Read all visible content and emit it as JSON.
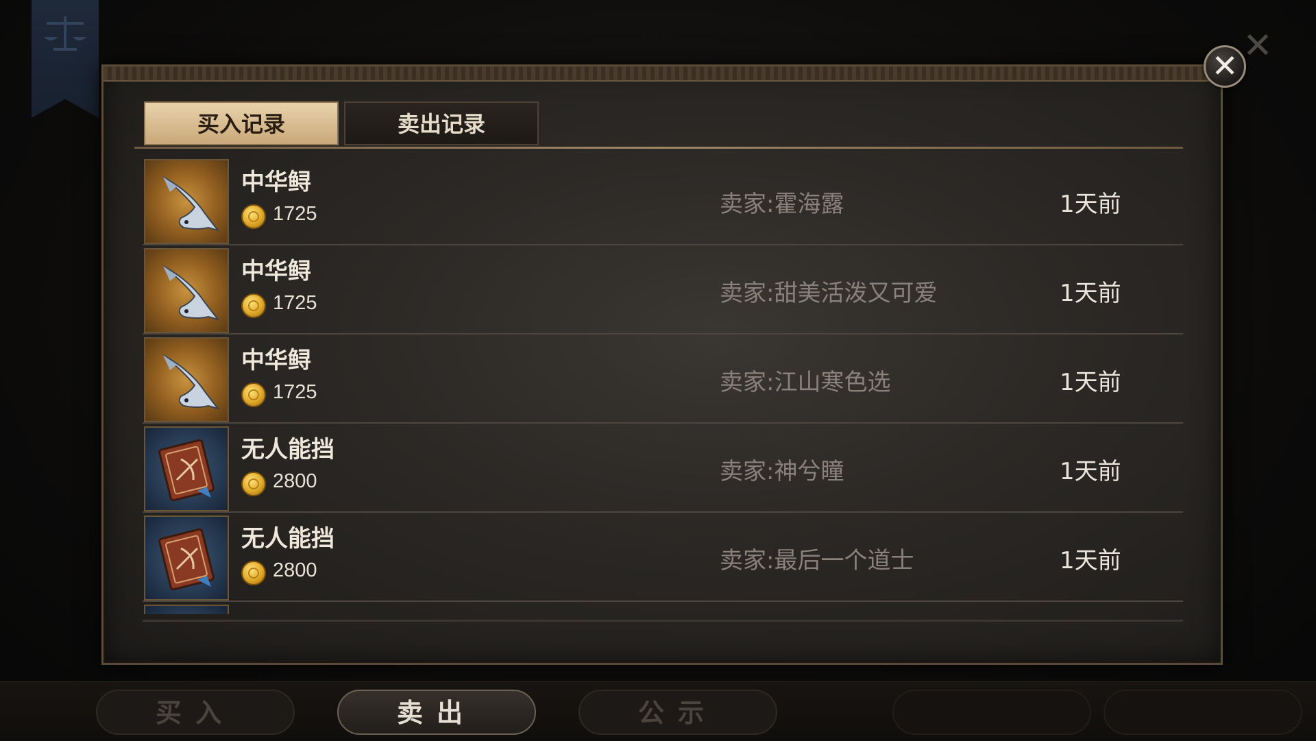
{
  "tabs": {
    "buy_records": "买入记录",
    "sell_records": "卖出记录"
  },
  "close_icon": "close-icon",
  "records": [
    {
      "name": "中华鲟",
      "price": "1725",
      "seller": "卖家:霍海露",
      "time": "1天前",
      "icon": "sturgeon-fish-icon"
    },
    {
      "name": "中华鲟",
      "price": "1725",
      "seller": "卖家:甜美活泼又可爱",
      "time": "1天前",
      "icon": "sturgeon-fish-icon"
    },
    {
      "name": "中华鲟",
      "price": "1725",
      "seller": "卖家:江山寒色选",
      "time": "1天前",
      "icon": "sturgeon-fish-icon"
    },
    {
      "name": "无人能挡",
      "price": "2800",
      "seller": "卖家:神兮瞳",
      "time": "1天前",
      "icon": "skill-book-icon"
    },
    {
      "name": "无人能挡",
      "price": "2800",
      "seller": "卖家:最后一个道士",
      "time": "1天前",
      "icon": "skill-book-icon"
    }
  ],
  "bottom_nav": {
    "buy": "买入",
    "sell": "卖出",
    "notice": "公示"
  },
  "colors": {
    "active_tab": "#e9d3ac",
    "coin": "#e0a828",
    "fish_bg": "#c9923e",
    "book_bg": "#3e5874"
  }
}
